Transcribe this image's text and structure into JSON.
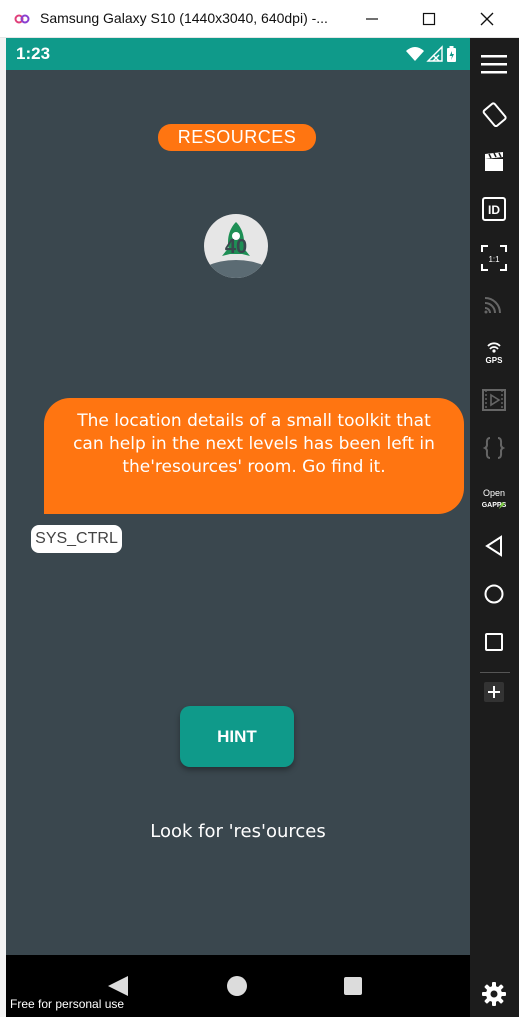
{
  "window": {
    "title": "Samsung Galaxy S10 (1440x3040, 640dpi) -...",
    "minimize_icon": "minimize-icon",
    "maximize_icon": "maximize-icon",
    "close_icon": "close-icon"
  },
  "statusbar": {
    "time": "1:23",
    "background": "#0f9a8a"
  },
  "screen": {
    "room_label": "RESOURCES",
    "level_icon": "rocket-level-icon",
    "level_number": "40",
    "message": "The location details of a small toolkit that can help in the next levels has been left in the'resources' room. Go find it.",
    "sender": "SYS_CTRL",
    "hint_button": "HINT",
    "hint_text": "Look for 'res'ources",
    "accent_color": "#ff7511",
    "background": "#3a474e"
  },
  "navbar": {
    "back_icon": "back-triangle-icon",
    "home_icon": "home-circle-icon",
    "recent_icon": "recent-square-icon",
    "watermark": "Free for personal use"
  },
  "toolbar": {
    "items": [
      {
        "icon": "menu-icon"
      },
      {
        "icon": "rotate-icon"
      },
      {
        "icon": "screen-record-icon"
      },
      {
        "icon": "id-icon"
      },
      {
        "icon": "pixel-perfect-icon",
        "label": "1:1"
      },
      {
        "icon": "cast-icon"
      },
      {
        "icon": "gps-icon",
        "label": "GPS"
      },
      {
        "icon": "media-icon"
      },
      {
        "icon": "braces-icon"
      },
      {
        "icon": "opengapps-icon",
        "label": "Open GAPPS"
      },
      {
        "icon": "back-icon"
      },
      {
        "icon": "home-icon"
      },
      {
        "icon": "overview-icon"
      },
      {
        "icon": "add-icon"
      },
      {
        "icon": "settings-icon"
      }
    ]
  }
}
